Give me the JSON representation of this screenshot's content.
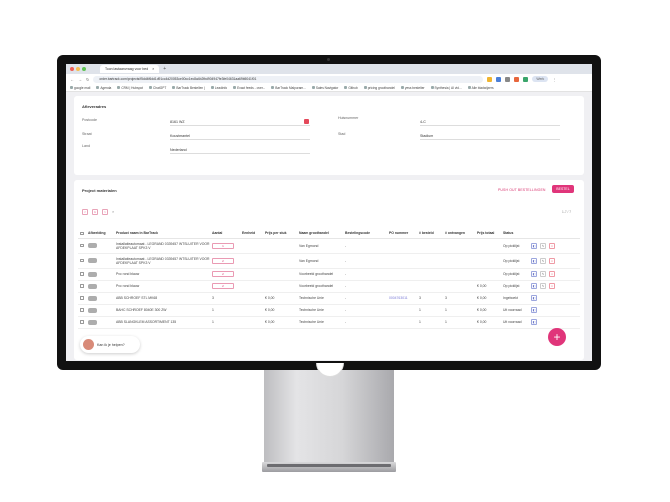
{
  "browser": {
    "tab_title": "Toon lastaanvraag voor bed",
    "url": "order.bartrack.com/projects/f5dd4f6dd1d91cc4d20053ce00cc1ec8a4b2fbd904947fe3fe04631aa69b5041f01",
    "profile_label": "Werk",
    "bookmarks": [
      "google mail",
      "Agenda",
      "CRM | Hubspot",
      "ChatGPT",
      "BarTrack Bestellen |",
      "Leadinfo",
      "Exact feeds - over...",
      "BarTrack Malpuram...",
      "Sales Navigator",
      "Github",
      "pricing groothandel",
      "yess bestelter",
      "Synthesia | AI vid...",
      "Alle bladwijzers"
    ]
  },
  "address_section": {
    "title": "Afleveradres",
    "postcode_label": "Postcode",
    "postcode_value": "8161 WZ",
    "huisnummer_label": "Huisnummer",
    "huisnummer_value": "4-C",
    "straat_label": "Straat",
    "straat_value": "Koustmantel",
    "stad_label": "Stad",
    "stad_value": "Stadium",
    "land_label": "Land",
    "land_value": "Nederland"
  },
  "materials": {
    "title": "Project materialen",
    "push_button": "PUSH OUT BESTELLINGEN",
    "order_button": "BESTEL",
    "page_info": "1-7 / 7",
    "page_buttons": [
      "<",
      "1",
      ">"
    ],
    "columns": [
      "Afbeelding",
      "Product naam in BarTrack",
      "Aantal",
      "Eenheid",
      "Prijs per stuk",
      "Naam groothandel",
      "Bestelingscode",
      "PO nummer",
      "# besteld",
      "# ontvangen",
      "Prijs totaal",
      "Status"
    ],
    "rows": [
      {
        "name": "Installatieautomaat - LEGRAND 0339457 WTSLUITER VOOR AFDEKPLAAT SPK3 V",
        "qty": "1",
        "qty_input": true,
        "unit": "",
        "price": "",
        "wholesaler": "Van Egmond",
        "code": "-",
        "po": "",
        "ordered": "",
        "received": "",
        "total": "",
        "status": "Op picklijst",
        "actions": [
          "blue",
          "grey",
          "red"
        ]
      },
      {
        "name": "Installatieautomaat - LEGRAND 0339457 WTSLUITER VOOR AFDEKPLAAT SPK3 V",
        "qty": "2",
        "qty_input": true,
        "unit": "",
        "price": "",
        "wholesaler": "Van Egmond",
        "code": "-",
        "po": "",
        "ordered": "",
        "received": "",
        "total": "",
        "status": "Op picklijst",
        "actions": [
          "blue",
          "grey",
          "red"
        ]
      },
      {
        "name": "Pvc rond blauw",
        "qty": "2",
        "qty_input": true,
        "unit": "",
        "price": "",
        "wholesaler": "Voorbeeld groothandel",
        "code": "-",
        "po": "",
        "ordered": "",
        "received": "",
        "total": "",
        "status": "Op picklijst",
        "actions": [
          "blue",
          "grey",
          "red"
        ]
      },
      {
        "name": "Pvc rond blauw",
        "qty": "2",
        "qty_input": true,
        "unit": "",
        "price": "",
        "wholesaler": "Voorbeeld groothandel",
        "code": "-",
        "po": "",
        "ordered": "",
        "received": "",
        "total": "€ 0,00",
        "status": "Op picklijst",
        "actions": [
          "blue",
          "grey",
          "red"
        ]
      },
      {
        "name": "ABB SCHROEF STL MK68",
        "qty": "3",
        "qty_input": false,
        "unit": "",
        "price": "€ 0,00",
        "wholesaler": "Technische Unie",
        "code": "-",
        "po": "0004763011",
        "ordered": "3",
        "received": "3",
        "total": "€ 0,00",
        "status": "Ingeboekt",
        "actions": [
          "blue"
        ]
      },
      {
        "name": "BAHC SCHROEF 8040E 300 ZW",
        "qty": "1",
        "qty_input": false,
        "unit": "",
        "price": "€ 0,00",
        "wholesaler": "Technische Unie",
        "code": "-",
        "po": "",
        "ordered": "1",
        "received": "1",
        "total": "€ 0,00",
        "status": "Uit voorraad",
        "actions": [
          "blue"
        ]
      },
      {
        "name": "ABB SLANGKLEM ASSORTIMENT 135",
        "qty": "1",
        "qty_input": false,
        "unit": "",
        "price": "€ 0,00",
        "wholesaler": "Technische Unie",
        "code": "-",
        "po": "",
        "ordered": "1",
        "received": "1",
        "total": "€ 0,00",
        "status": "Uit voorraad",
        "actions": [
          "blue"
        ]
      }
    ]
  },
  "chat": {
    "label": "Kan ik je helpen?"
  },
  "fab": {
    "label": "+"
  },
  "colors": {
    "accent": "#e0357a",
    "danger": "#e4485a",
    "link": "#7b7bd6"
  }
}
